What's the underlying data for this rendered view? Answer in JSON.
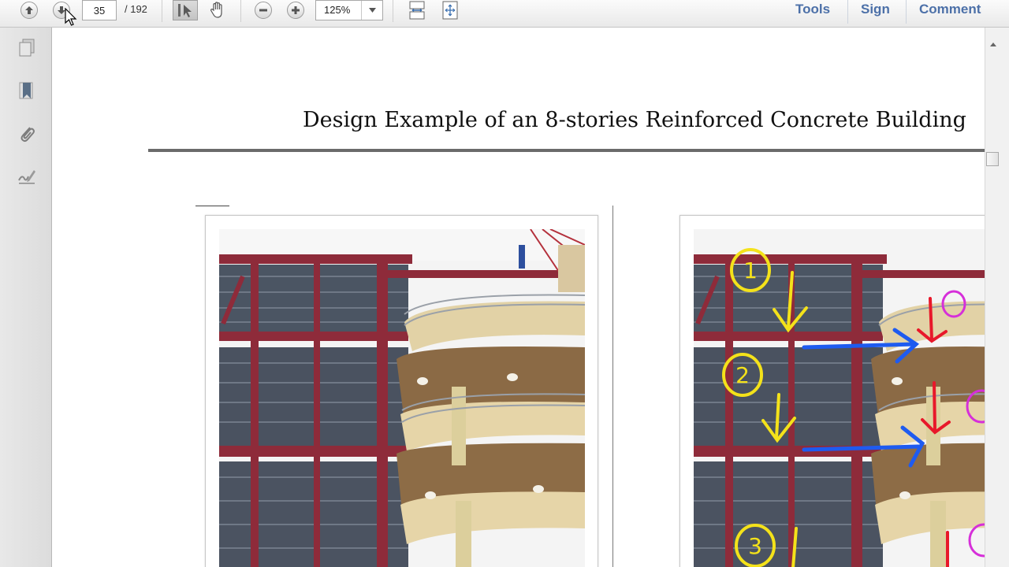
{
  "toolbar": {
    "page_current": "35",
    "page_total": "/ 192",
    "zoom_value": "125%",
    "tools_label": "Tools",
    "sign_label": "Sign",
    "comment_label": "Comment",
    "icons": [
      "prev-page-icon",
      "next-page-icon",
      "select-tool-icon",
      "hand-tool-icon",
      "zoom-out-icon",
      "zoom-in-icon",
      "fit-page-icon",
      "full-screen-icon",
      "dropdown-arrow-icon"
    ]
  },
  "sidebar": {
    "icons": [
      "pages-icon",
      "bookmark-icon",
      "attachment-icon",
      "signature-icon"
    ]
  },
  "document": {
    "title": "Design Example of an 8-stories Reinforced Concrete Building",
    "annotations": [
      "1",
      "2",
      "3"
    ]
  },
  "colors": {
    "link_blue": "#4c70a8",
    "annot_yellow": "#f4e21a",
    "annot_blue": "#1e5bf0",
    "annot_red": "#e8182a",
    "annot_magenta": "#d62fd9",
    "steel_frame": "#8e2b3a"
  }
}
